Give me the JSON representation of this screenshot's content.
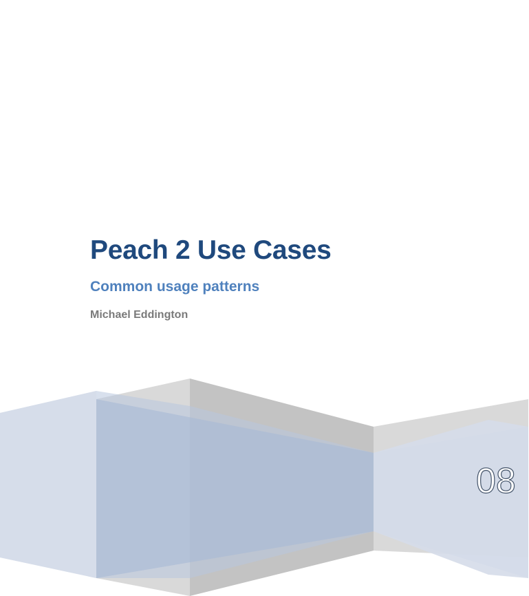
{
  "cover": {
    "title": "Peach 2 Use Cases",
    "subtitle": "Common usage patterns",
    "author": "Michael Eddington",
    "year": "08"
  },
  "colors": {
    "title": "#1f497d",
    "subtitle": "#4f81bd",
    "author": "#7a7a7a",
    "panel_blue": "#b8c7df",
    "panel_gray": "#c6c6c6"
  }
}
